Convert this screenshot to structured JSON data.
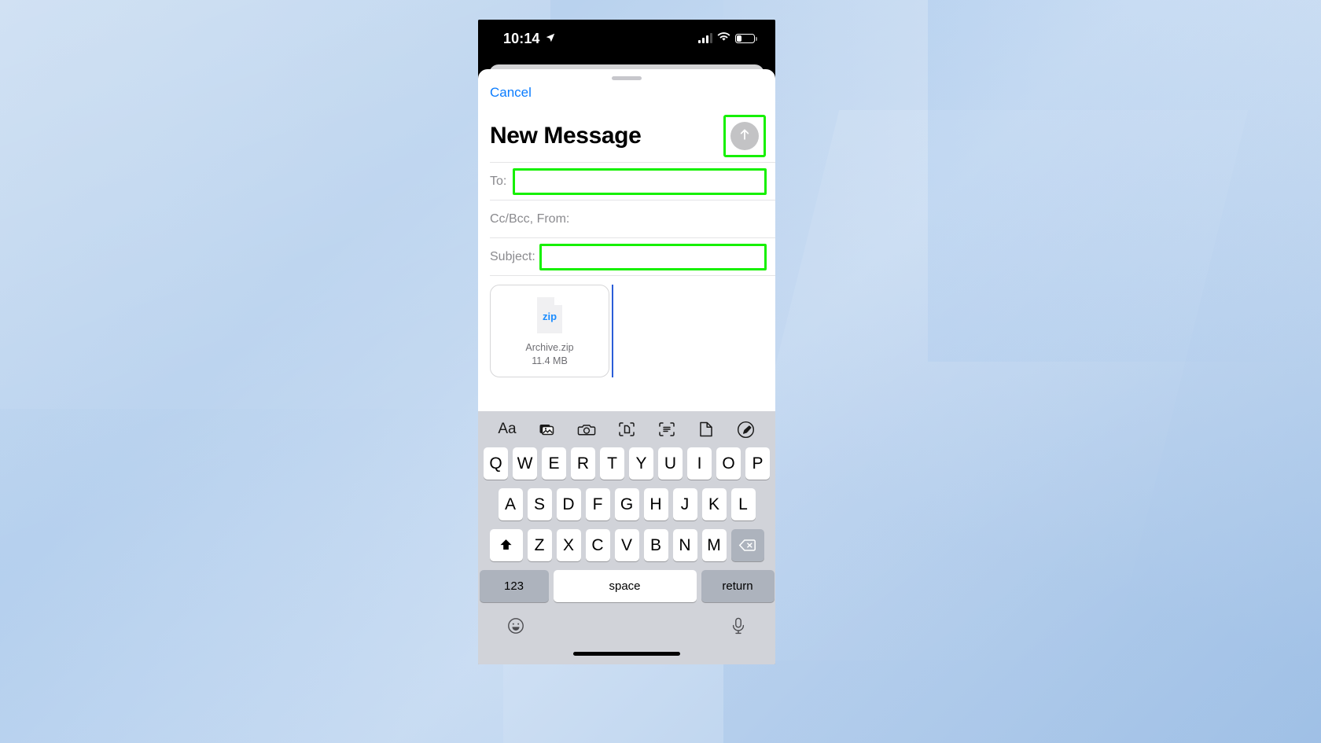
{
  "wallpaper": {
    "color_top": "#c4d9f0",
    "color_bottom": "#a8c6e8"
  },
  "status_bar": {
    "time": "10:14",
    "location_icon": "location-arrow-icon",
    "signal_icon": "cellular-signal-icon",
    "signal_bars_filled": 3,
    "signal_bars_total": 4,
    "wifi_icon": "wifi-icon",
    "battery_icon": "battery-icon",
    "battery_percent": 30
  },
  "sheet": {
    "cancel_label": "Cancel",
    "title": "New Message",
    "grabber": "sheet-grabber",
    "send_button": {
      "icon": "send-arrow-up-icon",
      "highlight_color": "#16f000",
      "circle_color": "#c3c3c5"
    }
  },
  "fields": {
    "to": {
      "label": "To:",
      "value": "",
      "highlighted": true
    },
    "ccbcc_from": {
      "label": "Cc/Bcc, From:",
      "value": ""
    },
    "subject": {
      "label": "Subject:",
      "value": "",
      "highlighted": true
    }
  },
  "body": {
    "attachment": {
      "icon": "zip-file-icon",
      "extension": "zip",
      "filename": "Archive.zip",
      "filesize": "11.4 MB"
    },
    "cursor_color": "#2a5dd8"
  },
  "keyboard": {
    "toolbar": [
      {
        "name": "text-format-icon",
        "label": "Aa"
      },
      {
        "name": "photo-library-icon",
        "label": ""
      },
      {
        "name": "camera-icon",
        "label": ""
      },
      {
        "name": "scan-document-icon",
        "label": ""
      },
      {
        "name": "scan-text-icon",
        "label": ""
      },
      {
        "name": "attach-file-icon",
        "label": ""
      },
      {
        "name": "markup-pen-icon",
        "label": ""
      }
    ],
    "row1": [
      "Q",
      "W",
      "E",
      "R",
      "T",
      "Y",
      "U",
      "I",
      "O",
      "P"
    ],
    "row2": [
      "A",
      "S",
      "D",
      "F",
      "G",
      "H",
      "J",
      "K",
      "L"
    ],
    "row3": [
      "Z",
      "X",
      "C",
      "V",
      "B",
      "N",
      "M"
    ],
    "shift_icon": "shift-key-icon",
    "backspace_icon": "backspace-key-icon",
    "numbers_label": "123",
    "space_label": "space",
    "return_label": "return",
    "emoji_icon": "emoji-keyboard-icon",
    "dictation_icon": "microphone-icon"
  }
}
